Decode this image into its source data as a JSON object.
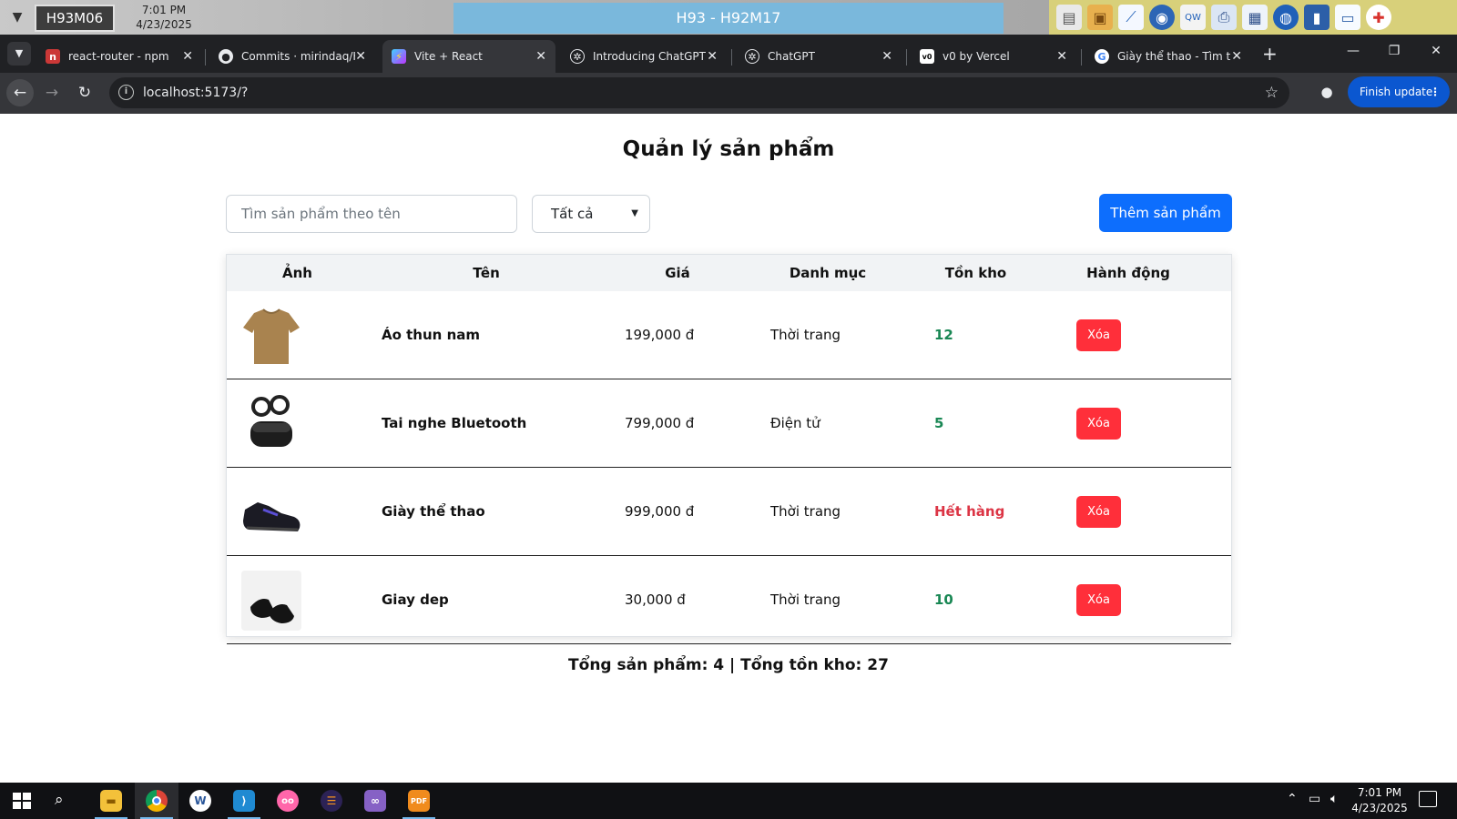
{
  "remote_desktop": {
    "host": "H93M06",
    "time": "7:01 PM",
    "date": "4/23/2025",
    "title": "H93 - H92M17",
    "tools": [
      "server-icon",
      "briefcase-icon",
      "chart-icon",
      "cd-icon",
      "keyboard-icon",
      "printer-icon",
      "window-icon",
      "globe-icon",
      "book-icon",
      "chat-icon",
      "lifebuoy-icon"
    ]
  },
  "tabs": [
    {
      "label": "react-router - npm",
      "icon": "npm-icon",
      "active": false
    },
    {
      "label": "Commits · mirindaq/KT",
      "icon": "github-icon",
      "active": false
    },
    {
      "label": "Vite + React",
      "icon": "vite-icon",
      "active": true
    },
    {
      "label": "Introducing ChatGPT |",
      "icon": "openai-icon",
      "active": false
    },
    {
      "label": "ChatGPT",
      "icon": "openai-icon",
      "active": false
    },
    {
      "label": "v0 by Vercel",
      "icon": "v0-icon",
      "active": false
    },
    {
      "label": "Giày thể thao - Tìm trê",
      "icon": "google-icon",
      "active": false
    }
  ],
  "browser": {
    "url": "localhost:5173/?",
    "finish_update": "Finish update"
  },
  "page": {
    "title": "Quản lý sản phẩm",
    "search_placeholder": "Tìm sản phẩm theo tên",
    "category_selected": "Tất cả",
    "add_button": "Thêm sản phẩm",
    "columns": {
      "image": "Ảnh",
      "name": "Tên",
      "price": "Giá",
      "category": "Danh mục",
      "stock": "Tồn kho",
      "actions": "Hành động"
    },
    "products": [
      {
        "name": "Áo thun nam",
        "price": "199,000 đ",
        "category": "Thời trang",
        "stock": "12",
        "in_stock": true,
        "action": "Xóa",
        "image": "tshirt"
      },
      {
        "name": "Tai nghe Bluetooth",
        "price": "799,000 đ",
        "category": "Điện tử",
        "stock": "5",
        "in_stock": true,
        "action": "Xóa",
        "image": "earbuds"
      },
      {
        "name": "Giày thể thao",
        "price": "999,000 đ",
        "category": "Thời trang",
        "stock": "Hết hàng",
        "in_stock": false,
        "action": "Xóa",
        "image": "sneaker"
      },
      {
        "name": "Giay dep",
        "price": "30,000 đ",
        "category": "Thời trang",
        "stock": "10",
        "in_stock": true,
        "action": "Xóa",
        "image": "dress-shoes"
      }
    ],
    "summary": "Tổng sản phẩm: 4 | Tổng tồn kho: 27"
  },
  "colors": {
    "primary": "#0d6efd",
    "danger": "#ff2f3a",
    "in_stock": "#198754",
    "out_of_stock": "#dc3545"
  },
  "taskbar": {
    "time": "7:01 PM",
    "date": "4/23/2025",
    "apps": [
      "file-explorer-icon",
      "chrome-icon",
      "wordpad-icon",
      "vscode-icon",
      "osu-icon",
      "eclipse-icon",
      "visual-studio-icon",
      "pdf-icon"
    ]
  }
}
